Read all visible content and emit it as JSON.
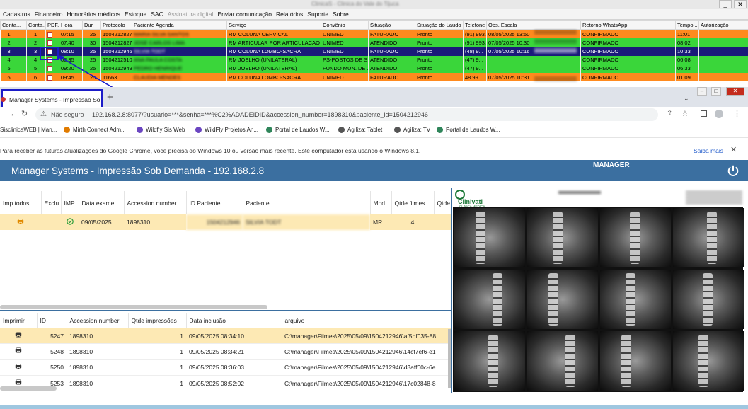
{
  "app": {
    "title": "ClinicaS - Clinica do Vale do Tijuca",
    "menu": [
      "Cadastros",
      "Financeiro",
      "Honorários médicos",
      "Estoque",
      "SAC",
      "Assinatura digital",
      "Enviar comunicação",
      "Relatórios",
      "Suporte",
      "Sobre"
    ],
    "menu_disabled": "Assinatura digital",
    "window_buttons": {
      "minimize": "_",
      "close": "✕"
    }
  },
  "schedule": {
    "columns": [
      "Conta...",
      "Conta...",
      "PDF...",
      "Hora",
      "Dur.",
      "Protocolo",
      "Paciente Agenda",
      "Serviço",
      "Convênio",
      "Situação",
      "Situação do Laudo",
      "Telefone",
      "Obs. Escala",
      "Retorno WhatsApp",
      "Tempo ...",
      "Autorização"
    ],
    "rows": [
      {
        "c1": "1",
        "c2": "1",
        "hora": "07:15",
        "dur": "25",
        "protocolo": "1504212827",
        "paciente": "MARIA SILVA SANTOS",
        "servico": "RM COLUNA CERVICAL",
        "convenio": "UNIMED",
        "situacao": "FATURADO",
        "laudo": "Pronto",
        "telefone": "(91) 993...",
        "obs": "08/05/2025 13:50",
        "retorno": "CONFIRMADO",
        "tempo": "11:01",
        "color": "#ff8a1e",
        "text": "#000"
      },
      {
        "c1": "2",
        "c2": "2",
        "hora": "07:40",
        "dur": "30",
        "protocolo": "1504212827",
        "paciente": "JOSE CARLOS LIMA",
        "servico": "RM ARTICULAR POR ARTICULACAO",
        "convenio": "UNIMED",
        "situacao": "ATENDIDO",
        "laudo": "Pronto",
        "telefone": "(91) 993...",
        "obs": "07/05/2025 10:30",
        "retorno": "CONFIRMADO",
        "tempo": "08:02",
        "color": "#3ad63a",
        "text": "#000"
      },
      {
        "c1": "3",
        "c2": "3",
        "hora": "08:10",
        "dur": "25",
        "protocolo": "1504212946",
        "paciente": "SILVIA TODT",
        "servico": "RM COLUNA LOMBO-SACRA",
        "convenio": "UNIMED",
        "situacao": "FATURADO",
        "laudo": "Pronto",
        "telefone": "(48) 9...",
        "obs": "07/05/2025 10:16",
        "retorno": "CONFIRMADO",
        "tempo": "10:33",
        "color": "#1a1a7a",
        "text": "#fff"
      },
      {
        "c1": "4",
        "c2": "4",
        "hora": "08:35",
        "dur": "25",
        "protocolo": "1504212510",
        "paciente": "ANA PAULA COSTA",
        "servico": "RM JOELHO (UNILATERAL)",
        "convenio": "PS-POSTOS DE S...",
        "situacao": "ATENDIDO",
        "laudo": "Pronto",
        "telefone": "(47) 9...",
        "obs": "",
        "retorno": "CONFIRMADO",
        "tempo": "06:08",
        "color": "#3ad63a",
        "text": "#000"
      },
      {
        "c1": "5",
        "c2": "5",
        "hora": "09:20",
        "dur": "25",
        "protocolo": "1504212949",
        "paciente": "PEDRO HENRIQUE",
        "servico": "RM JOELHO (UNILATERAL)",
        "convenio": "FUNDO MUN. DE ...",
        "situacao": "ATENDIDO",
        "laudo": "Pronto",
        "telefone": "(47) 9...",
        "obs": "",
        "retorno": "CONFIRMADO",
        "tempo": "06:33",
        "color": "#3ad63a",
        "text": "#000"
      },
      {
        "c1": "6",
        "c2": "6",
        "hora": "09:45",
        "dur": "25",
        "protocolo": "11663",
        "paciente": "CLAUDIA MENDES",
        "servico": "RM COLUNA LOMBO-SACRA",
        "convenio": "UNIMED",
        "situacao": "FATURADO",
        "laudo": "Pronto",
        "telefone": "48 99...",
        "obs": "07/05/2025 10:31",
        "retorno": "CONFIRMADO",
        "tempo": "01:09",
        "color": "#ff8a1e",
        "text": "#000"
      }
    ]
  },
  "browser": {
    "tab_title": "Manager Systems - Impressão Sob Demanda",
    "new_tab": "+",
    "security": "Não seguro",
    "url": "192.168.2.8:8077/?usuario=***&senha=***%C2%ADADEIDID&accession_number=1898310&paciente_id=1504212946",
    "bookmarks": [
      "SisclinicaWEB | Man...",
      "Mirth Connect Adm...",
      "Wildfly Sis Web",
      "WildFly Projetos An...",
      "Portal de Laudos W...",
      "Agiliza: Tablet",
      "Agiliza: TV",
      "Portal de Laudos W..."
    ],
    "bookmark_colors": [
      "#2b6cb0",
      "#e07b00",
      "#6b46c1",
      "#6b46c1",
      "#2f855a",
      "#555555",
      "#555555",
      "#2f855a"
    ],
    "infobar_text": "Para receber as futuras atualizações do Google Chrome, você precisa do Windows 10 ou versão mais recente. Este computador está usando o Windows 8.1.",
    "infobar_link": "Saiba mais"
  },
  "manager": {
    "title": "Manager Systems - Impressão Sob Demanda - 192.168.2.8",
    "user": "MANAGER",
    "exam_columns": [
      "Imp todos",
      "Exclu",
      "IMP",
      "Data exame",
      "Accession number",
      "ID Paciente",
      "Paciente",
      "Mod",
      "Qtde filmes",
      "Qtde"
    ],
    "exam_row": {
      "data": "09/05/2025",
      "accession": "1898310",
      "id_paciente": "1504212946",
      "paciente": "SILVIA TODT",
      "mod": "MR",
      "filmes": "4"
    },
    "print_columns": [
      "Imprimir",
      "ID",
      "Accession number",
      "Qtde impressões",
      "Data inclusão",
      "arquivo"
    ],
    "prints": [
      {
        "id": "5247",
        "acc": "1898310",
        "qtd": "1",
        "data": "09/05/2025 08:34:10",
        "arquivo": "C:\\manager\\Filmes\\2025\\05\\09\\1504212946\\af5bf035-88"
      },
      {
        "id": "5248",
        "acc": "1898310",
        "qtd": "1",
        "data": "09/05/2025 08:34:21",
        "arquivo": "C:\\manager\\Filmes\\2025\\05\\09\\1504212946\\14cf7ef6-e1"
      },
      {
        "id": "5250",
        "acc": "1898310",
        "qtd": "1",
        "data": "09/05/2025 08:36:03",
        "arquivo": "C:\\manager\\Filmes\\2025\\05\\09\\1504212946\\d3aff60c-6e"
      },
      {
        "id": "5253",
        "acc": "1898310",
        "qtd": "1",
        "data": "09/05/2025 08:52:02",
        "arquivo": "C:\\manager\\Filmes\\2025\\05\\09\\1504212946\\17c02848-8"
      }
    ],
    "film_brand": "Clinivati",
    "film_brand_sub": "CLINICA MEDICA"
  }
}
